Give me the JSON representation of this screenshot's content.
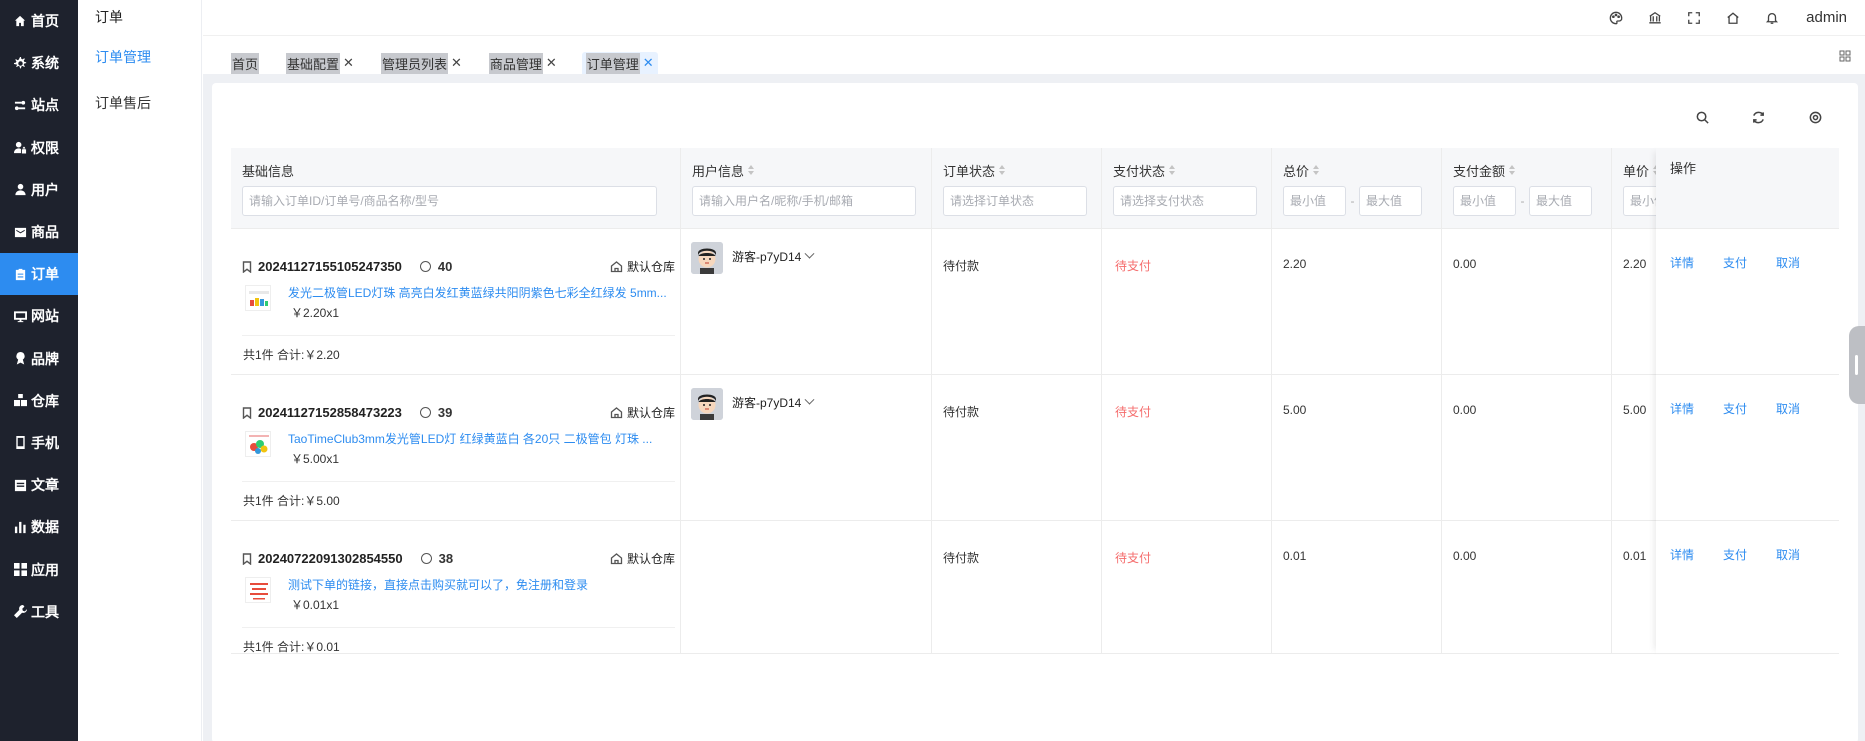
{
  "sidebar": {
    "items": [
      {
        "label": "首页",
        "icon": "home-icon",
        "active": false
      },
      {
        "label": "系统",
        "icon": "gear-icon",
        "active": false
      },
      {
        "label": "站点",
        "icon": "sliders-icon",
        "active": false
      },
      {
        "label": "权限",
        "icon": "user-lock-icon",
        "active": false
      },
      {
        "label": "用户",
        "icon": "user-icon",
        "active": false
      },
      {
        "label": "商品",
        "icon": "box-icon",
        "active": false
      },
      {
        "label": "订单",
        "icon": "clipboard-icon",
        "active": true
      },
      {
        "label": "网站",
        "icon": "monitor-icon",
        "active": false
      },
      {
        "label": "品牌",
        "icon": "badge-icon",
        "active": false
      },
      {
        "label": "仓库",
        "icon": "warehouse-icon",
        "active": false
      },
      {
        "label": "手机",
        "icon": "phone-icon",
        "active": false
      },
      {
        "label": "文章",
        "icon": "article-icon",
        "active": false
      },
      {
        "label": "数据",
        "icon": "bar-chart-icon",
        "active": false
      },
      {
        "label": "应用",
        "icon": "apps-icon",
        "active": false
      },
      {
        "label": "工具",
        "icon": "wrench-icon",
        "active": false
      }
    ]
  },
  "subnav": {
    "title": "订单",
    "items": [
      {
        "label": "订单管理",
        "active": true
      },
      {
        "label": "订单售后",
        "active": false
      }
    ]
  },
  "header": {
    "icons": [
      "palette-icon",
      "bank-icon",
      "fullscreen-icon",
      "home-icon",
      "bell-icon"
    ],
    "user": "admin"
  },
  "tabs": [
    {
      "label": "首页",
      "closable": false,
      "active": false
    },
    {
      "label": "基础配置",
      "closable": true,
      "active": false
    },
    {
      "label": "管理员列表",
      "closable": true,
      "active": false
    },
    {
      "label": "商品管理",
      "closable": true,
      "active": false
    },
    {
      "label": "订单管理",
      "closable": true,
      "active": true
    }
  ],
  "tab_close": "✕",
  "table": {
    "columns": {
      "basic": {
        "title": "基础信息",
        "placeholder": "请输入订单ID/订单号/商品名称/型号"
      },
      "user": {
        "title": "用户信息",
        "placeholder": "请输入用户名/昵称/手机/邮箱"
      },
      "order_status": {
        "title": "订单状态",
        "placeholder": "请选择订单状态"
      },
      "pay_status": {
        "title": "支付状态",
        "placeholder": "请选择支付状态"
      },
      "total": {
        "title": "总价",
        "min": "最小值",
        "max": "最大值"
      },
      "paid": {
        "title": "支付金额",
        "min": "最小值",
        "max": "最大值"
      },
      "unit": {
        "title": "单价",
        "min": "最小值"
      },
      "ops": {
        "title": "操作"
      }
    },
    "range_dash": "-",
    "rows": [
      {
        "order_no": "20241127155105247350",
        "count": "40",
        "warehouse": "默认仓库",
        "product_title": "发光二极管LED灯珠 高亮白发红黄蓝绿共阳阴紫色七彩全红绿发 5mm...",
        "product_price": "￥2.20x1",
        "summary": "共1件 合计:￥2.20",
        "user_name": "游客-p7yD14",
        "show_user": true,
        "order_status": "待付款",
        "pay_status": "待支付",
        "total": "2.20",
        "paid": "0.00",
        "unit": "2.20",
        "ops": [
          "详情",
          "支付",
          "取消"
        ]
      },
      {
        "order_no": "20241127152858473223",
        "count": "39",
        "warehouse": "默认仓库",
        "product_title": "TaoTimeClub3mm发光管LED灯 红绿黄蓝白 各20只 二极管包 灯珠 ...",
        "product_price": "￥5.00x1",
        "summary": "共1件 合计:￥5.00",
        "user_name": "游客-p7yD14",
        "show_user": true,
        "order_status": "待付款",
        "pay_status": "待支付",
        "total": "5.00",
        "paid": "0.00",
        "unit": "5.00",
        "ops": [
          "详情",
          "支付",
          "取消"
        ]
      },
      {
        "order_no": "20240722091302854550",
        "count": "38",
        "warehouse": "默认仓库",
        "product_title": "测试下单的链接，直接点击购买就可以了，免注册和登录",
        "product_price": "￥0.01x1",
        "summary": "共1件 合计:￥0.01",
        "user_name": "",
        "show_user": false,
        "order_status": "待付款",
        "pay_status": "待支付",
        "total": "0.01",
        "paid": "0.00",
        "unit": "0.01",
        "ops": [
          "详情",
          "支付",
          "取消"
        ]
      }
    ]
  },
  "colors": {
    "accent": "#2d8cf0",
    "sidebar_bg": "#1e222d",
    "danger": "#f56c6c"
  }
}
